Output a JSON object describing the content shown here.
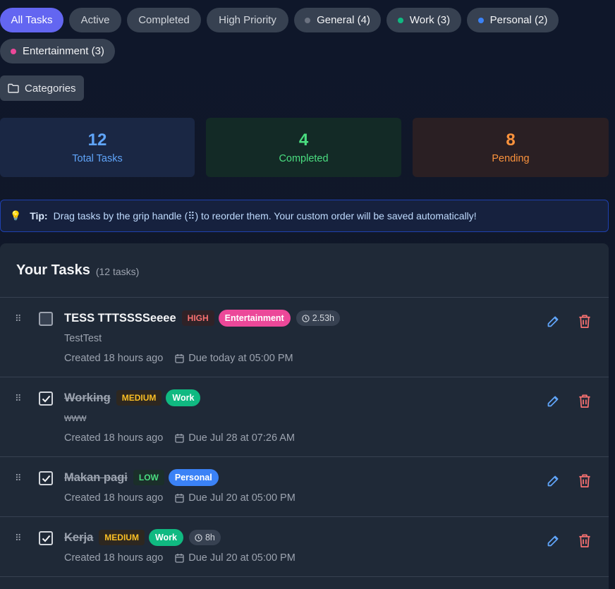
{
  "filters": {
    "all": "All Tasks",
    "active": "Active",
    "completed": "Completed",
    "high_priority": "High Priority",
    "general": "General (4)",
    "work": "Work (3)",
    "personal": "Personal (2)",
    "entertainment": "Entertainment (3)"
  },
  "colors": {
    "accent": "#6366f1",
    "general": "#6b7280",
    "work": "#10b981",
    "personal": "#3b82f6",
    "entertainment": "#ec4899"
  },
  "categories_button": "Categories",
  "stats": {
    "total": {
      "value": "12",
      "label": "Total Tasks"
    },
    "completed": {
      "value": "4",
      "label": "Completed"
    },
    "pending": {
      "value": "8",
      "label": "Pending"
    }
  },
  "tip": {
    "label": "Tip:",
    "text": "Drag tasks by the grip handle (⠿) to reorder them. Your custom order will be saved automatically!"
  },
  "panel": {
    "title": "Your Tasks",
    "count": "(12 tasks)"
  },
  "tasks": [
    {
      "title": "TESS TTTSSSSeeee",
      "priority": "HIGH",
      "category": "Entertainment",
      "time": "2.53h",
      "description": "TestTest",
      "created": "Created 18 hours ago",
      "due": "Due today at 05:00 PM",
      "completed": false
    },
    {
      "title": "Working",
      "priority": "MEDIUM",
      "category": "Work",
      "description": "www",
      "created": "Created 18 hours ago",
      "due": "Due Jul 28 at 07:26 AM",
      "completed": true
    },
    {
      "title": "Makan pagi",
      "priority": "LOW",
      "category": "Personal",
      "created": "Created 18 hours ago",
      "due": "Due Jul 20 at 05:00 PM",
      "completed": true
    },
    {
      "title": "Kerja",
      "priority": "MEDIUM",
      "category": "Work",
      "time": "8h",
      "created": "Created 18 hours ago",
      "due": "Due Jul 20 at 05:00 PM",
      "completed": true
    }
  ]
}
